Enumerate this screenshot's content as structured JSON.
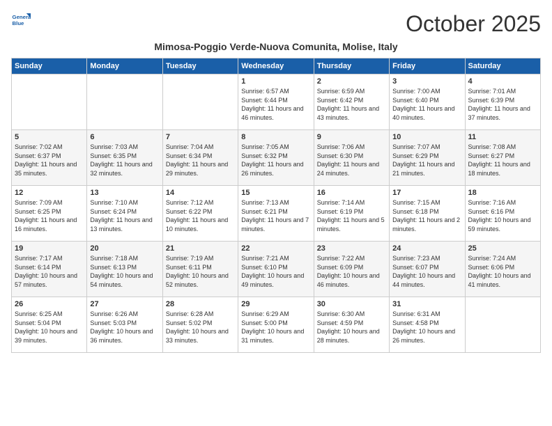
{
  "header": {
    "logo_line1": "General",
    "logo_line2": "Blue",
    "title": "October 2025",
    "subtitle": "Mimosa-Poggio Verde-Nuova Comunita, Molise, Italy"
  },
  "weekdays": [
    "Sunday",
    "Monday",
    "Tuesday",
    "Wednesday",
    "Thursday",
    "Friday",
    "Saturday"
  ],
  "weeks": [
    [
      {
        "day": "",
        "info": ""
      },
      {
        "day": "",
        "info": ""
      },
      {
        "day": "",
        "info": ""
      },
      {
        "day": "1",
        "info": "Sunrise: 6:57 AM\nSunset: 6:44 PM\nDaylight: 11 hours and 46 minutes."
      },
      {
        "day": "2",
        "info": "Sunrise: 6:59 AM\nSunset: 6:42 PM\nDaylight: 11 hours and 43 minutes."
      },
      {
        "day": "3",
        "info": "Sunrise: 7:00 AM\nSunset: 6:40 PM\nDaylight: 11 hours and 40 minutes."
      },
      {
        "day": "4",
        "info": "Sunrise: 7:01 AM\nSunset: 6:39 PM\nDaylight: 11 hours and 37 minutes."
      }
    ],
    [
      {
        "day": "5",
        "info": "Sunrise: 7:02 AM\nSunset: 6:37 PM\nDaylight: 11 hours and 35 minutes."
      },
      {
        "day": "6",
        "info": "Sunrise: 7:03 AM\nSunset: 6:35 PM\nDaylight: 11 hours and 32 minutes."
      },
      {
        "day": "7",
        "info": "Sunrise: 7:04 AM\nSunset: 6:34 PM\nDaylight: 11 hours and 29 minutes."
      },
      {
        "day": "8",
        "info": "Sunrise: 7:05 AM\nSunset: 6:32 PM\nDaylight: 11 hours and 26 minutes."
      },
      {
        "day": "9",
        "info": "Sunrise: 7:06 AM\nSunset: 6:30 PM\nDaylight: 11 hours and 24 minutes."
      },
      {
        "day": "10",
        "info": "Sunrise: 7:07 AM\nSunset: 6:29 PM\nDaylight: 11 hours and 21 minutes."
      },
      {
        "day": "11",
        "info": "Sunrise: 7:08 AM\nSunset: 6:27 PM\nDaylight: 11 hours and 18 minutes."
      }
    ],
    [
      {
        "day": "12",
        "info": "Sunrise: 7:09 AM\nSunset: 6:25 PM\nDaylight: 11 hours and 16 minutes."
      },
      {
        "day": "13",
        "info": "Sunrise: 7:10 AM\nSunset: 6:24 PM\nDaylight: 11 hours and 13 minutes."
      },
      {
        "day": "14",
        "info": "Sunrise: 7:12 AM\nSunset: 6:22 PM\nDaylight: 11 hours and 10 minutes."
      },
      {
        "day": "15",
        "info": "Sunrise: 7:13 AM\nSunset: 6:21 PM\nDaylight: 11 hours and 7 minutes."
      },
      {
        "day": "16",
        "info": "Sunrise: 7:14 AM\nSunset: 6:19 PM\nDaylight: 11 hours and 5 minutes."
      },
      {
        "day": "17",
        "info": "Sunrise: 7:15 AM\nSunset: 6:18 PM\nDaylight: 11 hours and 2 minutes."
      },
      {
        "day": "18",
        "info": "Sunrise: 7:16 AM\nSunset: 6:16 PM\nDaylight: 10 hours and 59 minutes."
      }
    ],
    [
      {
        "day": "19",
        "info": "Sunrise: 7:17 AM\nSunset: 6:14 PM\nDaylight: 10 hours and 57 minutes."
      },
      {
        "day": "20",
        "info": "Sunrise: 7:18 AM\nSunset: 6:13 PM\nDaylight: 10 hours and 54 minutes."
      },
      {
        "day": "21",
        "info": "Sunrise: 7:19 AM\nSunset: 6:11 PM\nDaylight: 10 hours and 52 minutes."
      },
      {
        "day": "22",
        "info": "Sunrise: 7:21 AM\nSunset: 6:10 PM\nDaylight: 10 hours and 49 minutes."
      },
      {
        "day": "23",
        "info": "Sunrise: 7:22 AM\nSunset: 6:09 PM\nDaylight: 10 hours and 46 minutes."
      },
      {
        "day": "24",
        "info": "Sunrise: 7:23 AM\nSunset: 6:07 PM\nDaylight: 10 hours and 44 minutes."
      },
      {
        "day": "25",
        "info": "Sunrise: 7:24 AM\nSunset: 6:06 PM\nDaylight: 10 hours and 41 minutes."
      }
    ],
    [
      {
        "day": "26",
        "info": "Sunrise: 6:25 AM\nSunset: 5:04 PM\nDaylight: 10 hours and 39 minutes."
      },
      {
        "day": "27",
        "info": "Sunrise: 6:26 AM\nSunset: 5:03 PM\nDaylight: 10 hours and 36 minutes."
      },
      {
        "day": "28",
        "info": "Sunrise: 6:28 AM\nSunset: 5:02 PM\nDaylight: 10 hours and 33 minutes."
      },
      {
        "day": "29",
        "info": "Sunrise: 6:29 AM\nSunset: 5:00 PM\nDaylight: 10 hours and 31 minutes."
      },
      {
        "day": "30",
        "info": "Sunrise: 6:30 AM\nSunset: 4:59 PM\nDaylight: 10 hours and 28 minutes."
      },
      {
        "day": "31",
        "info": "Sunrise: 6:31 AM\nSunset: 4:58 PM\nDaylight: 10 hours and 26 minutes."
      },
      {
        "day": "",
        "info": ""
      }
    ]
  ]
}
